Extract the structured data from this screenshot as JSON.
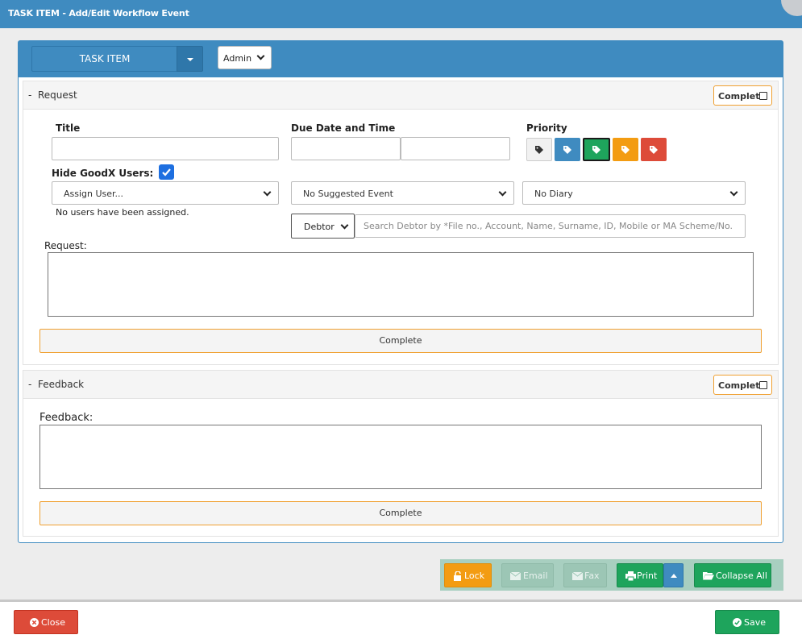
{
  "window": {
    "title": "TASK ITEM - Add/Edit Workflow Event"
  },
  "header": {
    "task_button": "TASK ITEM",
    "role_select": "Admin"
  },
  "request": {
    "section_title": "Request",
    "collapse_glyph": "-",
    "complete_toggle": "Complete",
    "complete_checked": false,
    "title_label": "Title",
    "title_value": "",
    "due_label": "Due Date and Time",
    "due_date_value": "",
    "due_time_value": "",
    "priority_label": "Priority",
    "priority_options": [
      {
        "color": "#f1f1f1",
        "icon": "tag-icon"
      },
      {
        "color": "#3f8bc0",
        "icon": "tag-icon"
      },
      {
        "color": "#1ea45c",
        "icon": "tag-icon",
        "selected": true
      },
      {
        "color": "#f39c12",
        "icon": "tag-icon"
      },
      {
        "color": "#dd4b39",
        "icon": "tag-icon"
      }
    ],
    "hide_users_label": "Hide GoodX Users:",
    "hide_users_checked": true,
    "assign_user_select": "Assign User...",
    "no_users_text": "No users have been assigned.",
    "suggested_event_select": "No Suggested Event",
    "diary_select": "No Diary",
    "debtor_select": "Debtor",
    "debtor_search_placeholder": "Search Debtor by *File no., Account, Name, Surname, ID, Mobile or MA Scheme/No.",
    "request_label": "Request:",
    "request_value": "",
    "complete_button": "Complete"
  },
  "feedback": {
    "section_title": "Feedback",
    "collapse_glyph": "-",
    "complete_toggle": "Complete",
    "complete_checked": false,
    "feedback_label": "Feedback:",
    "feedback_value": "",
    "complete_button": "Complete"
  },
  "toolbar": {
    "lock": "Lock",
    "email": "Email",
    "fax": "Fax",
    "print": "Print",
    "collapse_all": "Collapse All"
  },
  "footer": {
    "close": "Close",
    "save": "Save"
  },
  "colors": {
    "brand_blue": "#3f8bc0",
    "success_green": "#1ea45c",
    "warning_orange": "#f39c12",
    "danger_red": "#dd4b39"
  }
}
